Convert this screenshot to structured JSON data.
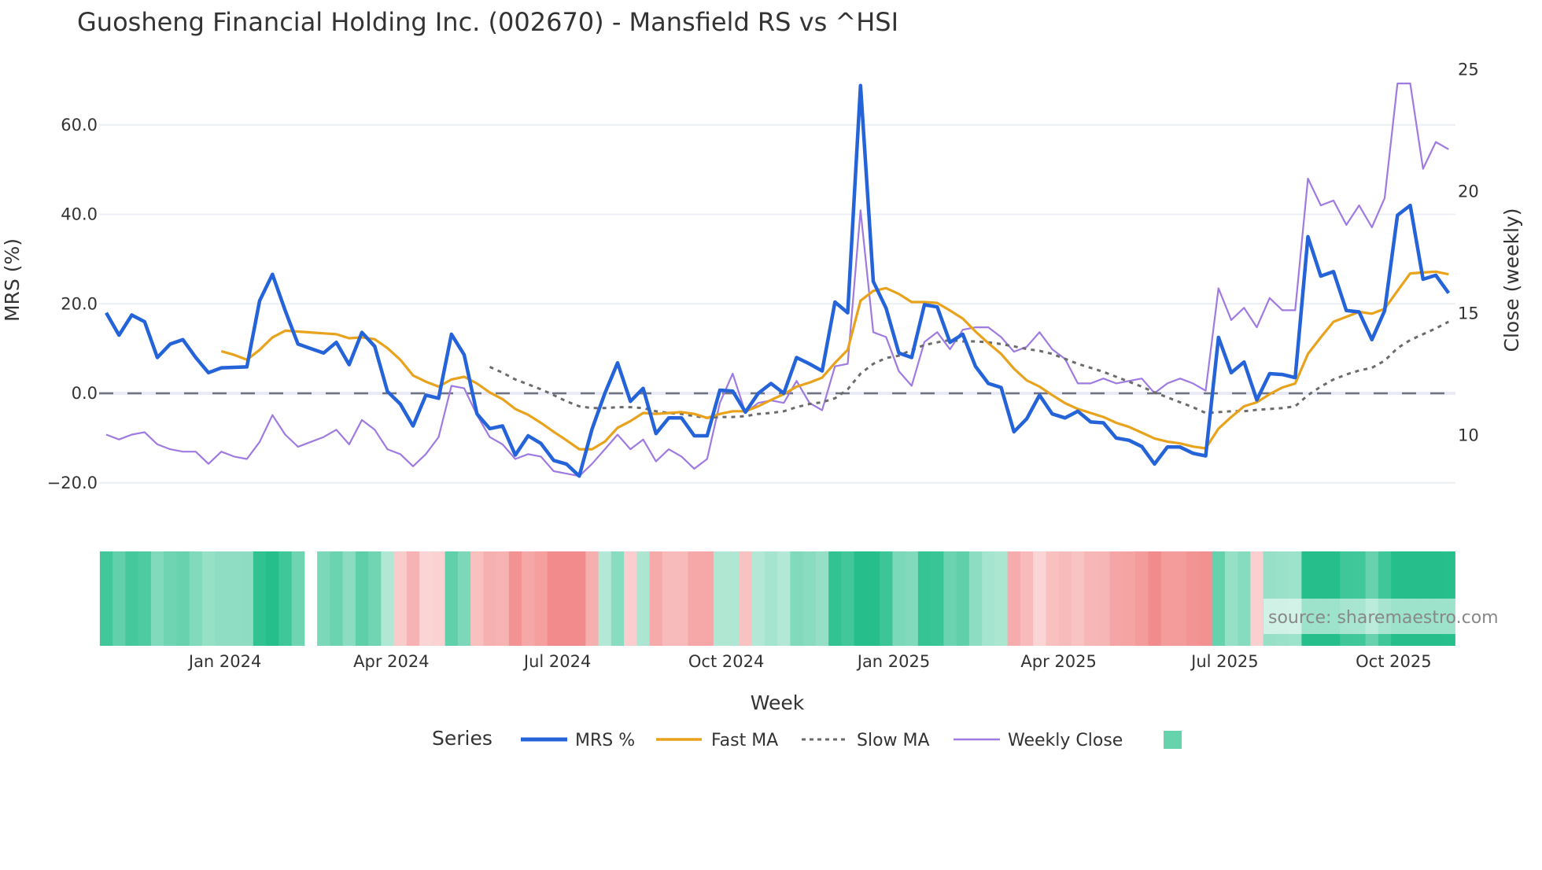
{
  "colors": {
    "mrs": "#2563d9",
    "fast": "#e8a21c",
    "slow": "#6b6b6b",
    "close": "#9f7ae0",
    "pos": "#26bf8c",
    "neg": "#f28b8b",
    "legend_heat": "#66d3ad"
  },
  "chart_data": {
    "type": "line",
    "title": "Guosheng Financial Holding Inc. (002670) - Mansfield RS vs ^HSI",
    "xlabel": "Week",
    "ylabel": "MRS (%)",
    "y2label": "Close (weekly)",
    "ylim": [
      -24,
      73
    ],
    "y2lim": [
      8.0,
      25.3
    ],
    "yticks": [
      -20,
      0,
      20,
      40,
      60
    ],
    "ytick_labels": [
      "−20.0",
      "0.0",
      "20.0",
      "40.0",
      "60.0"
    ],
    "y2ticks": [
      10,
      15,
      20,
      25
    ],
    "y2tick_labels": [
      "10",
      "15",
      "20",
      "25"
    ],
    "xticks": [
      {
        "week": 9.3,
        "label": "Jan 2024"
      },
      {
        "week": 22.3,
        "label": "Apr 2024"
      },
      {
        "week": 35.3,
        "label": "Jul 2024"
      },
      {
        "week": 48.5,
        "label": "Oct 2024"
      },
      {
        "week": 61.6,
        "label": "Jan 2025"
      },
      {
        "week": 74.5,
        "label": "Apr 2025"
      },
      {
        "week": 87.5,
        "label": "Jul 2025"
      },
      {
        "week": 100.7,
        "label": "Oct 2025"
      }
    ],
    "zero_line": 0,
    "grid": true,
    "legend_title": "Series",
    "legend_position": "bottom",
    "series": [
      {
        "name": "MRS %",
        "axis": "y",
        "values": [
          18,
          13,
          17.5,
          16,
          8,
          11,
          12,
          8,
          4.6,
          5.7,
          5.8,
          5.9,
          20.7,
          26.6,
          18.5,
          11,
          10,
          9,
          11.4,
          6.4,
          13.6,
          10.5,
          0.4,
          -2.4,
          -7.3,
          -0.4,
          -1.1,
          13.2,
          8.6,
          -4.6,
          -7.9,
          -7.3,
          -13.8,
          -9.5,
          -11.2,
          -15,
          -15.8,
          -18.5,
          -8,
          0,
          6.8,
          -1.8,
          1.1,
          -9,
          -5.5,
          -5.5,
          -9.5,
          -9.5,
          0.7,
          0.5,
          -4.2,
          0,
          2.2,
          0,
          8,
          6.6,
          5,
          20.4,
          18,
          68.8,
          25,
          19,
          9,
          8,
          19.8,
          19.3,
          11.4,
          13.2,
          6,
          2.2,
          1.3,
          -8.6,
          -5.7,
          -0.4,
          -4.6,
          -5.5,
          -4,
          -6.4,
          -6.6,
          -10,
          -10.5,
          -11.9,
          -15.8,
          -12,
          -12,
          -13.4,
          -14,
          12.5,
          4.6,
          7,
          -1.5,
          4.4,
          4.2,
          3.5,
          35,
          26.2,
          27.2,
          18.5,
          18.2,
          12,
          18.5,
          39.8,
          42,
          25.5,
          26.4,
          22.4
        ]
      },
      {
        "name": "Fast MA",
        "axis": "y",
        "values": [
          null,
          null,
          null,
          null,
          null,
          null,
          null,
          null,
          null,
          9.4,
          8.6,
          7.5,
          9.7,
          12.5,
          14,
          13.8,
          13.6,
          13.4,
          13.2,
          12.3,
          12.5,
          12.1,
          10.1,
          7.5,
          4,
          2.6,
          1.5,
          3.1,
          3.7,
          2.2,
          0.2,
          -1.3,
          -3.5,
          -4.8,
          -6.6,
          -8.6,
          -10.5,
          -12.5,
          -12.5,
          -10.8,
          -7.7,
          -6.2,
          -4.4,
          -4.6,
          -4.4,
          -4.2,
          -4.6,
          -5.5,
          -4.6,
          -4,
          -4,
          -2.9,
          -1.5,
          -0.2,
          1.5,
          2.4,
          3.5,
          6.8,
          9.7,
          20.7,
          22.9,
          23.5,
          22.2,
          20.4,
          20.4,
          20.2,
          18.5,
          16.7,
          13.8,
          11.2,
          8.8,
          5.5,
          2.9,
          1.5,
          -0.4,
          -2.2,
          -3.5,
          -4.4,
          -5.3,
          -6.6,
          -7.5,
          -8.8,
          -10.1,
          -10.8,
          -11.2,
          -11.9,
          -12.3,
          -7.9,
          -5.3,
          -2.9,
          -2,
          -0.2,
          1.3,
          2.2,
          8.8,
          12.5,
          16,
          17.1,
          18.2,
          17.8,
          18.9,
          22.9,
          26.8,
          27,
          27.2,
          26.6
        ]
      },
      {
        "name": "Slow MA",
        "axis": "y",
        "values": [
          null,
          null,
          null,
          null,
          null,
          null,
          null,
          null,
          null,
          null,
          null,
          null,
          null,
          null,
          null,
          null,
          null,
          null,
          null,
          null,
          null,
          null,
          null,
          null,
          null,
          null,
          null,
          null,
          null,
          null,
          5.9,
          4.6,
          3.1,
          2,
          0.9,
          -0.4,
          -1.8,
          -2.9,
          -3.3,
          -3.3,
          -3.1,
          -3.1,
          -3.3,
          -4,
          -4.4,
          -4.6,
          -5.1,
          -5.5,
          -5.3,
          -5.3,
          -5.1,
          -4.6,
          -4.4,
          -4,
          -3.1,
          -2.4,
          -2,
          -1.1,
          0.9,
          4.4,
          6.6,
          7.9,
          8.4,
          9.7,
          10.8,
          11.4,
          11.9,
          11.6,
          11.6,
          11.4,
          11,
          10.5,
          9.9,
          9.5,
          8.8,
          7.7,
          6.6,
          5.7,
          4.8,
          3.7,
          2.6,
          1.5,
          0.2,
          -0.9,
          -2,
          -3.1,
          -4.4,
          -4.2,
          -4,
          -4,
          -3.7,
          -3.5,
          -3.3,
          -2.9,
          -0.4,
          1.5,
          3.1,
          4.2,
          5.1,
          5.7,
          7.3,
          10.1,
          11.9,
          13.2,
          14.5,
          16
        ]
      },
      {
        "name": "Weekly Close",
        "axis": "y2",
        "values": [
          10.0,
          9.8,
          10.0,
          10.1,
          9.6,
          9.4,
          9.3,
          9.3,
          8.8,
          9.3,
          9.1,
          9.0,
          9.7,
          10.8,
          10.0,
          9.5,
          9.7,
          9.9,
          10.2,
          9.6,
          10.6,
          10.2,
          9.4,
          9.2,
          8.7,
          9.2,
          9.9,
          12.0,
          11.9,
          10.8,
          9.9,
          9.6,
          9.0,
          9.2,
          9.1,
          8.5,
          8.4,
          8.3,
          8.8,
          9.4,
          10.0,
          9.4,
          9.8,
          8.9,
          9.4,
          9.1,
          8.6,
          9.0,
          11.3,
          12.5,
          10.9,
          11.3,
          11.4,
          11.3,
          12.2,
          11.3,
          11.0,
          12.8,
          12.9,
          19.2,
          14.2,
          14.0,
          12.6,
          12.0,
          13.8,
          14.2,
          13.5,
          14.3,
          14.4,
          14.4,
          14.0,
          13.4,
          13.6,
          14.2,
          13.5,
          13.1,
          12.1,
          12.1,
          12.3,
          12.1,
          12.2,
          12.3,
          11.7,
          12.1,
          12.3,
          12.1,
          11.8,
          16.0,
          14.7,
          15.2,
          14.4,
          15.6,
          15.1,
          15.1,
          20.5,
          19.4,
          19.6,
          18.6,
          19.4,
          18.5,
          19.7,
          24.4,
          24.4,
          20.9,
          22.0,
          21.7
        ]
      }
    ],
    "heatmap_gap_week": 16
  },
  "source": "source: sharemaestro.com"
}
